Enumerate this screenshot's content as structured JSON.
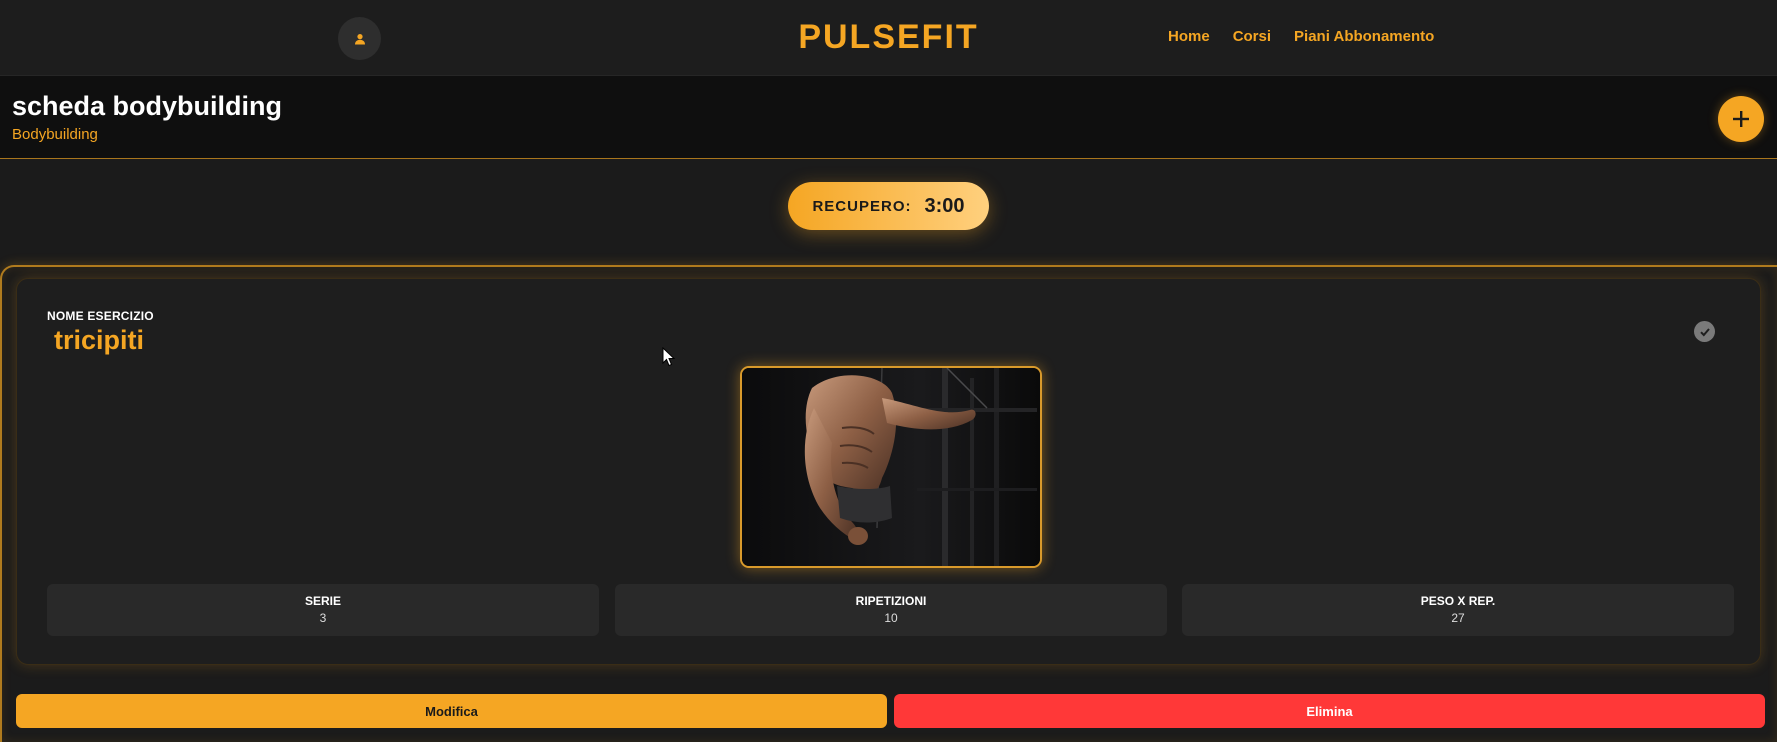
{
  "navbar": {
    "brand": "PULSEFIT",
    "links": [
      "Home",
      "Corsi",
      "Piani Abbonamento"
    ],
    "user_icon": "user-icon"
  },
  "header": {
    "title": "scheda bodybuilding",
    "subtitle": "Bodybuilding",
    "add_icon": "plus-icon"
  },
  "rest": {
    "label": "RECUPERO:",
    "value": "3:00"
  },
  "exercise": {
    "label": "NOME ESERCIZIO",
    "name": "tricipiti",
    "status_icon": "check-circle-icon",
    "image_icon": "exercise-photo",
    "stats": [
      {
        "label": "SERIE",
        "value": "3"
      },
      {
        "label": "RIPETIZIONI",
        "value": "10"
      },
      {
        "label": "PESO X REP.",
        "value": "27"
      }
    ]
  },
  "actions": {
    "edit": "Modifica",
    "delete": "Elimina"
  },
  "colors": {
    "accent": "#f5a623",
    "danger": "#ff3838",
    "background": "#1b1b1b"
  }
}
